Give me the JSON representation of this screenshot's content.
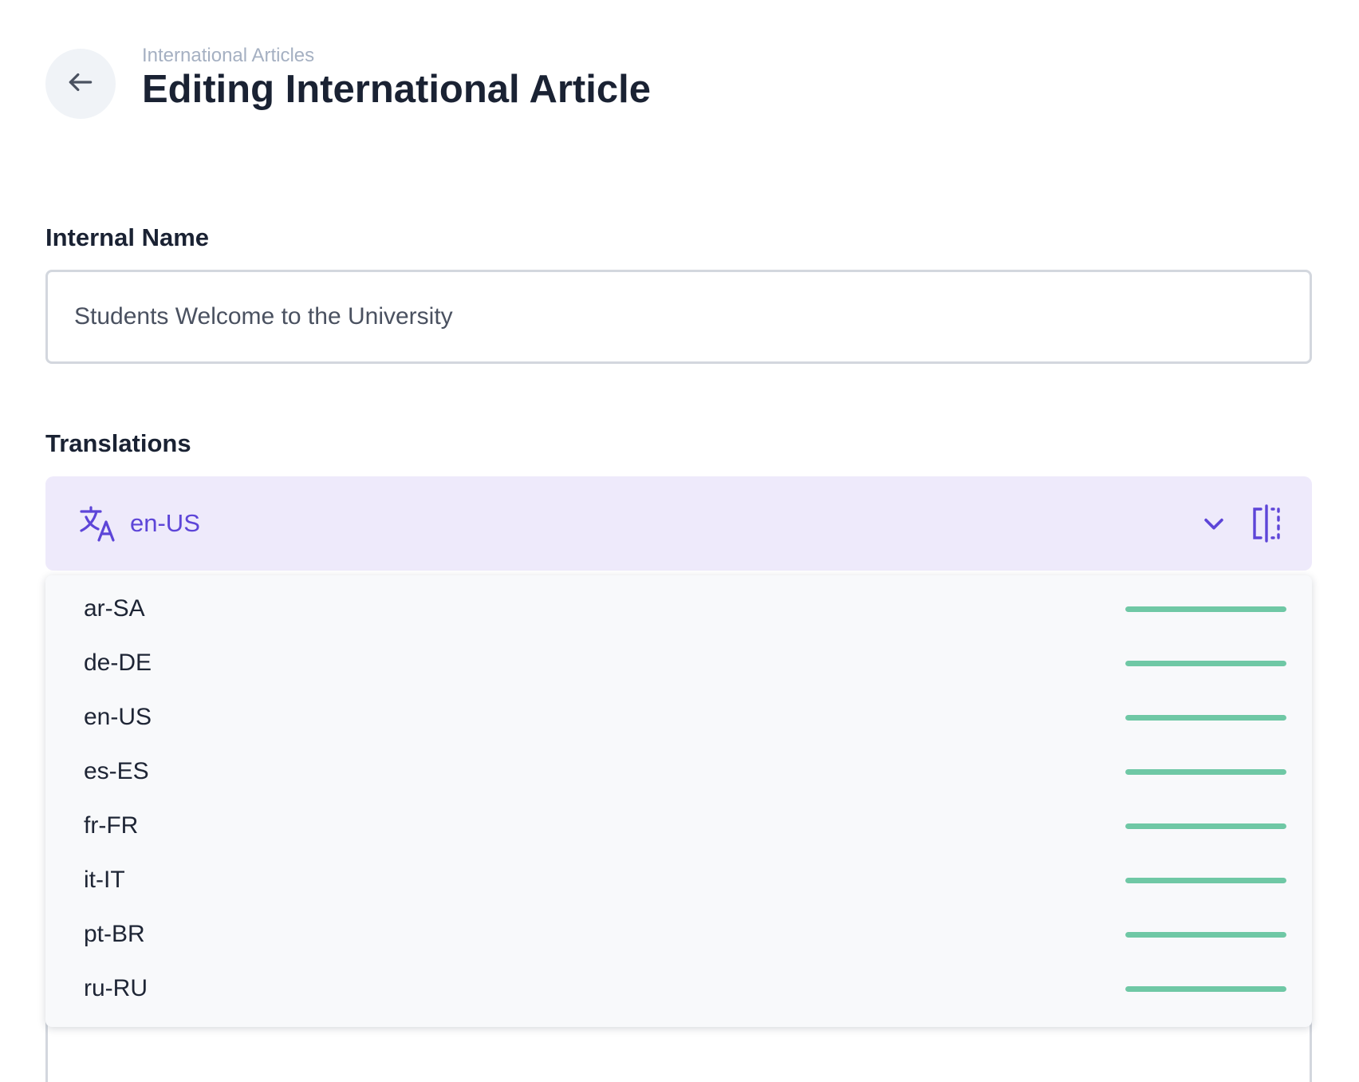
{
  "header": {
    "breadcrumb": "International Articles",
    "title": "Editing International Article",
    "back_icon": "arrow-left-icon"
  },
  "internal_name": {
    "label": "Internal Name",
    "value": "Students Welcome to the University"
  },
  "translations": {
    "label": "Translations",
    "selected_locale": "en-US",
    "icons": {
      "translate": "translate-icon",
      "chevron": "chevron-down-icon",
      "split": "split-view-icon"
    },
    "locales": [
      {
        "code": "ar-SA",
        "progress": 1.0
      },
      {
        "code": "de-DE",
        "progress": 1.0
      },
      {
        "code": "en-US",
        "progress": 1.0
      },
      {
        "code": "es-ES",
        "progress": 1.0
      },
      {
        "code": "fr-FR",
        "progress": 1.0
      },
      {
        "code": "it-IT",
        "progress": 1.0
      },
      {
        "code": "pt-BR",
        "progress": 1.0
      },
      {
        "code": "ru-RU",
        "progress": 1.0
      }
    ]
  },
  "colors": {
    "accent": "#5d45d8",
    "accent_bg": "#eeeafb",
    "progress": "#6fc8a5"
  }
}
